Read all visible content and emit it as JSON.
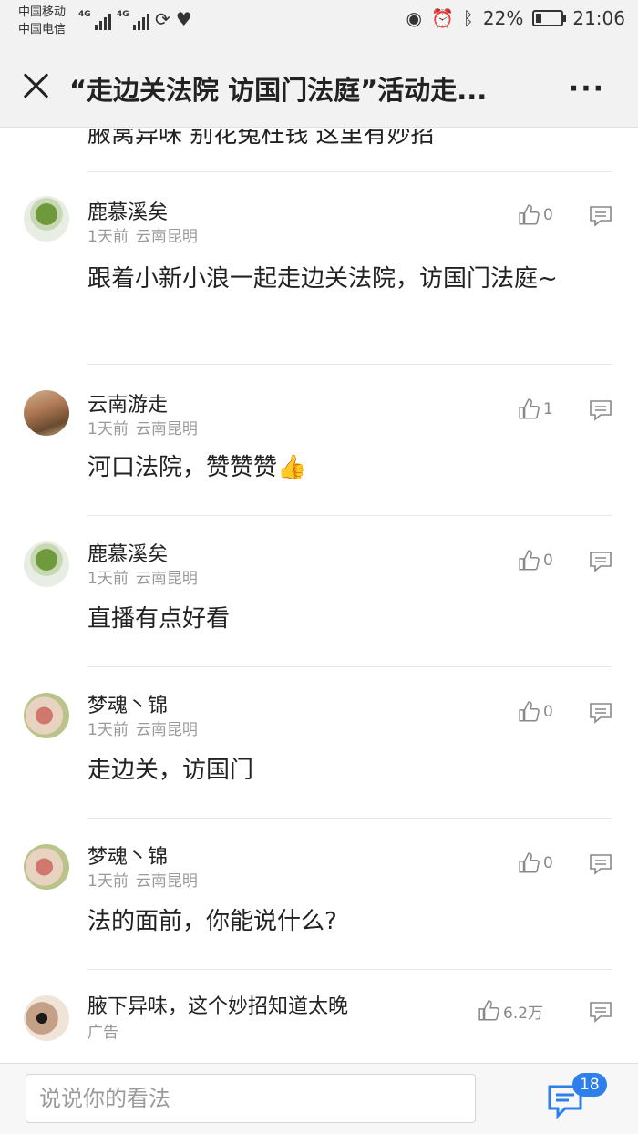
{
  "status_bar": {
    "carrier_1": "中国移动",
    "carrier_2": "中国电信",
    "net_1": "4G",
    "net_2": "4G",
    "battery": "22%",
    "time": "21:06"
  },
  "header": {
    "title": "“走边关法院 访国门法庭”活动走...",
    "more_label": "···"
  },
  "clipped_text": "腋窝异味 别花冤枉钱 这里有妙招",
  "comments": [
    {
      "name": "鹿慕溪矣",
      "time": "1天前",
      "location": "云南昆明",
      "likes": "0",
      "text": "跟着小新小浪一起走边关法院，访国门法庭~"
    },
    {
      "name": "云南游走",
      "time": "1天前",
      "location": "云南昆明",
      "likes": "1",
      "text": "河口法院，赞赞赞👍"
    },
    {
      "name": "鹿慕溪矣",
      "time": "1天前",
      "location": "云南昆明",
      "likes": "0",
      "text": "直播有点好看"
    },
    {
      "name": "梦魂丶锦",
      "time": "1天前",
      "location": "云南昆明",
      "likes": "0",
      "text": "走边关，访国门"
    },
    {
      "name": "梦魂丶锦",
      "time": "1天前",
      "location": "云南昆明",
      "likes": "0",
      "text": "法的面前，你能说什么?"
    }
  ],
  "ad": {
    "title": "腋下异味，这个妙招知道太晚",
    "label": "广告",
    "likes": "6.2万",
    "peek": "腋窝异味 别花冤枉钱 这里有妙招"
  },
  "bottom_bar": {
    "input_placeholder": "说说你的看法",
    "comment_count": "18"
  },
  "icons": [
    "close-icon",
    "more-icon",
    "like-icon",
    "reply-icon",
    "comments-icon",
    "eye-icon",
    "alarm-icon",
    "bluetooth-icon",
    "battery-icon"
  ]
}
